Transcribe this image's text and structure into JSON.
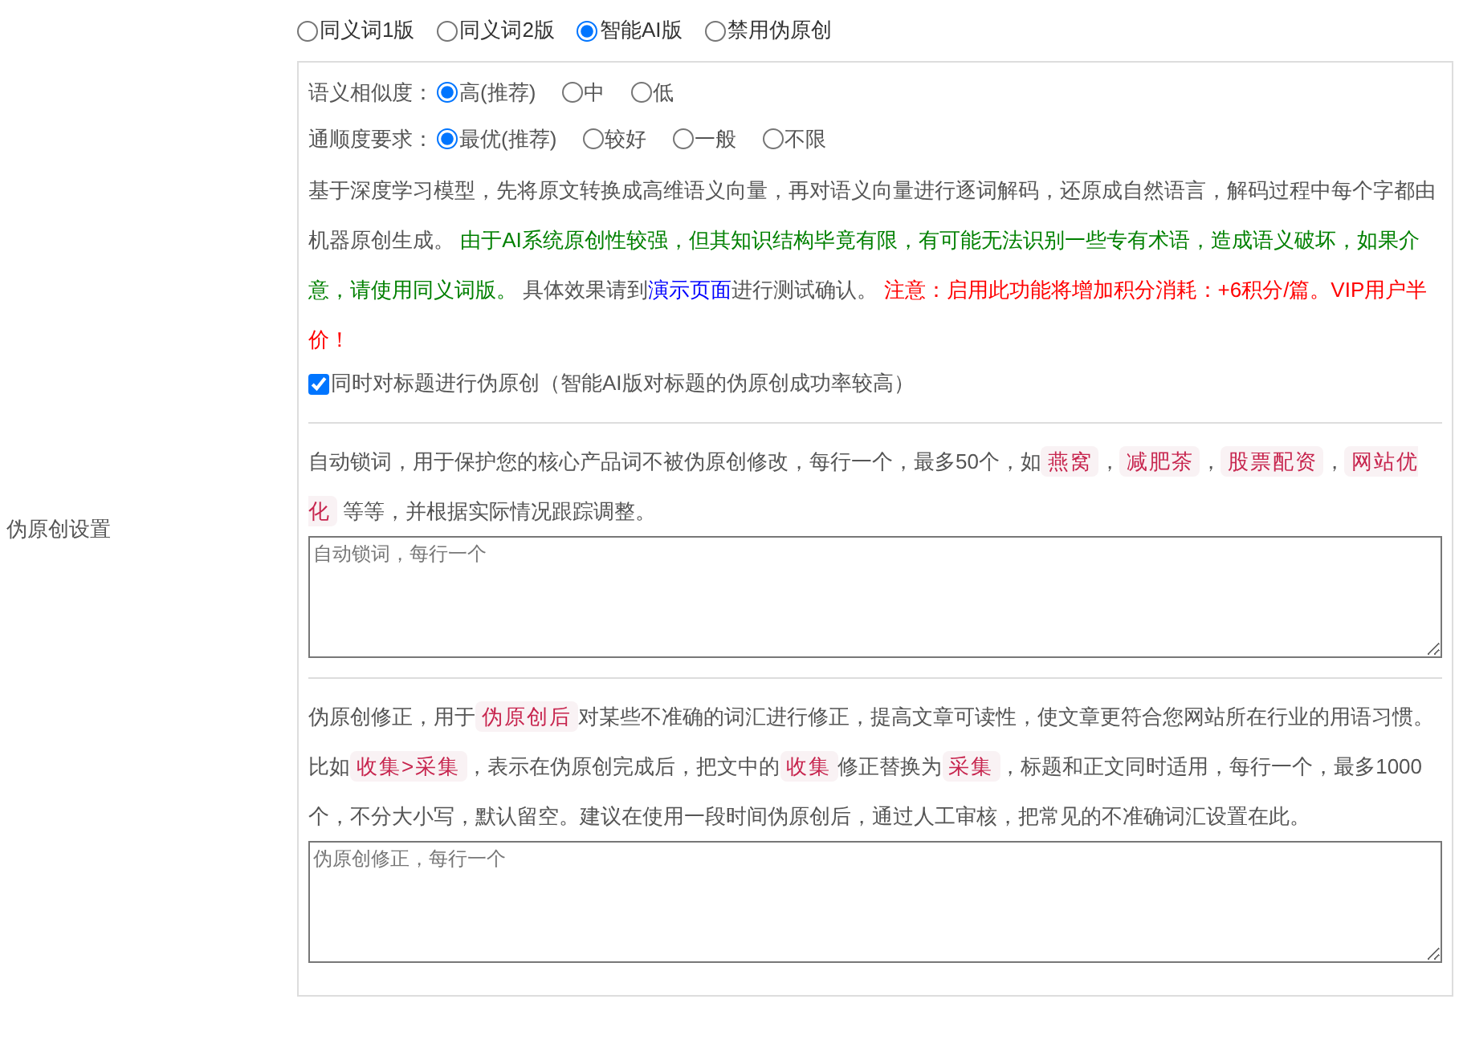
{
  "section_label": "伪原创设置",
  "modes": [
    {
      "label": "同义词1版",
      "selected": false
    },
    {
      "label": "同义词2版",
      "selected": false
    },
    {
      "label": "智能AI版",
      "selected": true
    },
    {
      "label": "禁用伪原创",
      "selected": false
    }
  ],
  "similarity": {
    "label": "语义相似度：",
    "options": [
      {
        "label": "高(推荐)",
        "selected": true
      },
      {
        "label": "中",
        "selected": false
      },
      {
        "label": "低",
        "selected": false
      }
    ]
  },
  "fluency": {
    "label": "通顺度要求：",
    "options": [
      {
        "label": "最优(推荐)",
        "selected": true
      },
      {
        "label": "较好",
        "selected": false
      },
      {
        "label": "一般",
        "selected": false
      },
      {
        "label": "不限",
        "selected": false
      }
    ]
  },
  "ai_description": [
    {
      "kind": "text",
      "text": "基于深度学习模型，先将原文转换成高维语义向量，再对语义向量进行逐词解码，还原成自然语言，解码过程中每个字都由机器原创生成。 "
    },
    {
      "kind": "green",
      "text": "由于AI系统原创性较强，但其知识结构毕竟有限，有可能无法识别一些专有术语，造成语义破坏，如果介意，请使用同义词版。"
    },
    {
      "kind": "text",
      "text": " 具体效果请到"
    },
    {
      "kind": "link",
      "text": "演示页面"
    },
    {
      "kind": "text",
      "text": "进行测试确认。 "
    },
    {
      "kind": "red",
      "text": "注意：启用此功能将增加积分消耗：+6积分/篇。VIP用户半价！"
    }
  ],
  "title_option": {
    "label": "同时对标题进行伪原创（智能AI版对标题的伪原创成功率较高）",
    "checked": true
  },
  "lock_words": {
    "description": [
      {
        "kind": "text",
        "text": "自动锁词，用于保护您的核心产品词不被伪原创修改，每行一个，最多50个，如"
      },
      {
        "kind": "code",
        "text": "燕窝"
      },
      {
        "kind": "text",
        "text": "，"
      },
      {
        "kind": "code",
        "text": "减肥茶"
      },
      {
        "kind": "text",
        "text": "，"
      },
      {
        "kind": "code",
        "text": "股票配资"
      },
      {
        "kind": "text",
        "text": "，"
      },
      {
        "kind": "code",
        "text": "网站优化"
      },
      {
        "kind": "text",
        "text": " 等等，并根据实际情况跟踪调整。"
      }
    ],
    "placeholder": "自动锁词，每行一个"
  },
  "corrections": {
    "description": [
      {
        "kind": "text",
        "text": "伪原创修正，用于"
      },
      {
        "kind": "code",
        "text": "伪原创后"
      },
      {
        "kind": "text",
        "text": "对某些不准确的词汇进行修正，提高文章可读性，使文章更符合您网站所在行业的用语习惯。比如"
      },
      {
        "kind": "code",
        "text": "收集>采集"
      },
      {
        "kind": "text",
        "text": "，表示在伪原创完成后，把文中的"
      },
      {
        "kind": "code",
        "text": "收集"
      },
      {
        "kind": "text",
        "text": "修正替换为"
      },
      {
        "kind": "code",
        "text": "采集"
      },
      {
        "kind": "text",
        "text": "，标题和正文同时适用，每行一个，最多1000个，不分大小写，默认留空。建议在使用一段时间伪原创后，通过人工审核，把常见的不准确词汇设置在此。"
      }
    ],
    "placeholder": "伪原创修正，每行一个"
  }
}
